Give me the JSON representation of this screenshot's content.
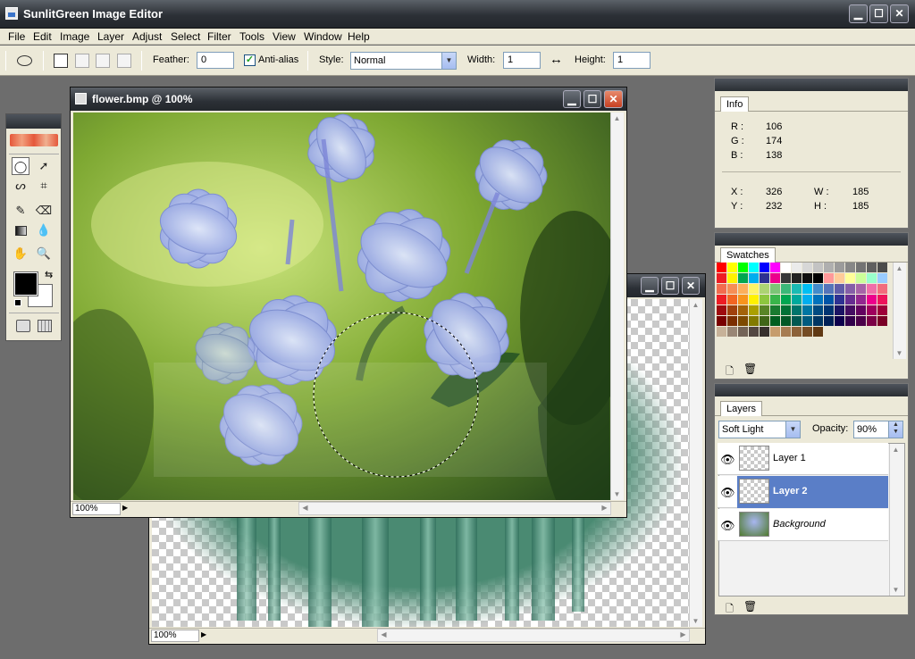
{
  "app": {
    "title": "SunlitGreen Image Editor"
  },
  "menu": [
    "File",
    "Edit",
    "Image",
    "Layer",
    "Adjust",
    "Select",
    "Filter",
    "Tools",
    "View",
    "Window",
    "Help"
  ],
  "options": {
    "feather_label": "Feather:",
    "feather_value": "0",
    "antialias_label": "Anti-alias",
    "antialias_checked": true,
    "style_label": "Style:",
    "style_value": "Normal",
    "width_label": "Width:",
    "width_value": "1",
    "height_label": "Height:",
    "height_value": "1"
  },
  "info": {
    "tab": "Info",
    "r_label": "R :",
    "r_value": "106",
    "g_label": "G :",
    "g_value": "174",
    "b_label": "B :",
    "b_value": "138",
    "x_label": "X :",
    "x_value": "326",
    "y_label": "Y :",
    "y_value": "232",
    "w_label": "W :",
    "w_value": "185",
    "h_label": "H :",
    "h_value": "185"
  },
  "swatches": {
    "tab": "Swatches",
    "colors": [
      "#ff0000",
      "#ffff00",
      "#00ff00",
      "#00ffff",
      "#0000ff",
      "#ff00ff",
      "#ffffff",
      "#ebebeb",
      "#d7d7d7",
      "#c3c3c3",
      "#afafaf",
      "#9b9b9b",
      "#878787",
      "#737373",
      "#5f5f5f",
      "#4b4b4b",
      "#ee1c24",
      "#fff200",
      "#00a651",
      "#00aeef",
      "#2e3192",
      "#ec008c",
      "#373737",
      "#232323",
      "#0f0f0f",
      "#000000",
      "#ff9999",
      "#ffcc99",
      "#ffff99",
      "#ccff99",
      "#99ffcc",
      "#99ccff",
      "#f26c4f",
      "#f68e56",
      "#fbaf5c",
      "#fff467",
      "#acd373",
      "#7cc576",
      "#3bb878",
      "#1abbb4",
      "#00bff3",
      "#438ccb",
      "#5574b9",
      "#605ca8",
      "#855fa8",
      "#a763a8",
      "#f06ea9",
      "#f26d7d",
      "#ed1c24",
      "#f26522",
      "#f7941d",
      "#fff200",
      "#8dc63f",
      "#39b54a",
      "#00a651",
      "#00a99d",
      "#00aeef",
      "#0072bc",
      "#0054a6",
      "#2e3192",
      "#662d91",
      "#92278f",
      "#ec008c",
      "#ed145b",
      "#9e0b0f",
      "#a0410d",
      "#a36209",
      "#aba000",
      "#598527",
      "#197b30",
      "#007236",
      "#00746b",
      "#0076a3",
      "#004a80",
      "#003471",
      "#1b1464",
      "#440e62",
      "#630460",
      "#9e005d",
      "#9e0039",
      "#790000",
      "#7b2e00",
      "#7d4900",
      "#827b00",
      "#406618",
      "#005e20",
      "#005826",
      "#005952",
      "#005b7f",
      "#003663",
      "#002157",
      "#0d004c",
      "#32004b",
      "#4b0049",
      "#7b0046",
      "#7a0026",
      "#c7b299",
      "#998675",
      "#736357",
      "#534741",
      "#37302d",
      "#c69c6d",
      "#a67c52",
      "#8c6239",
      "#754c24",
      "#603913"
    ]
  },
  "layers": {
    "tab": "Layers",
    "blend_mode": "Soft Light",
    "opacity_label": "Opacity:",
    "opacity_value": "90%",
    "items": [
      {
        "name": "Layer 1",
        "selected": false
      },
      {
        "name": "Layer 2",
        "selected": true
      },
      {
        "name": "Background",
        "selected": false
      }
    ]
  },
  "doc_main": {
    "title": "flower.bmp @ 100%",
    "zoom": "100%"
  },
  "doc_back": {
    "zoom": "100%"
  }
}
